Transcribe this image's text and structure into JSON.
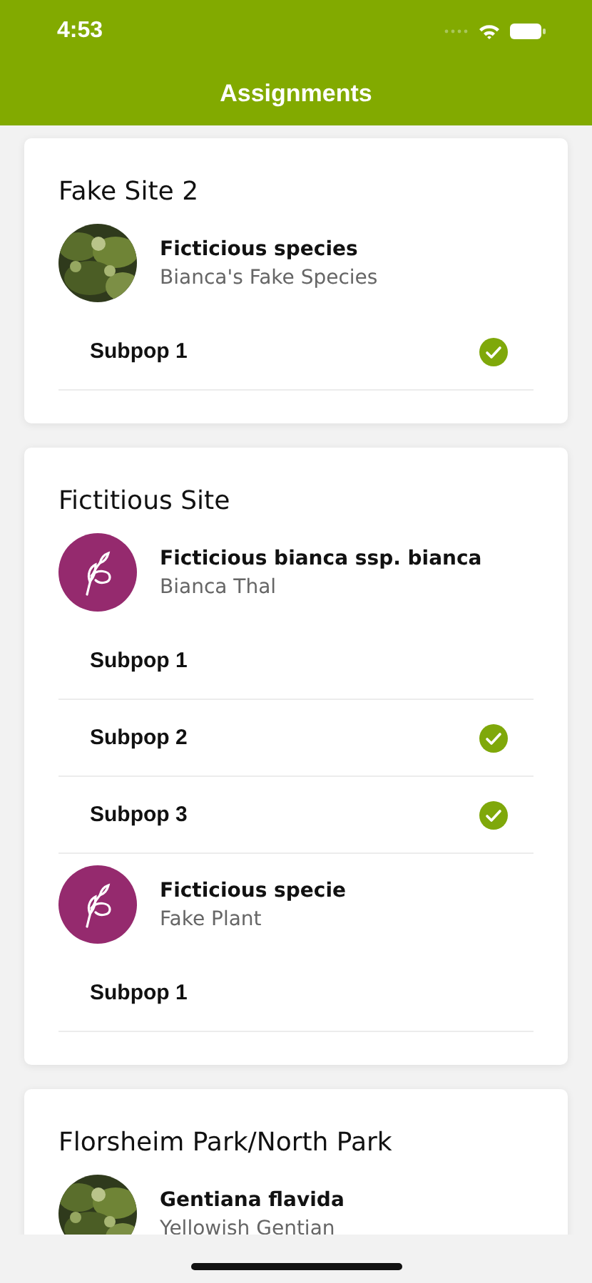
{
  "status_bar": {
    "time": "4:53"
  },
  "header": {
    "title": "Assignments"
  },
  "sites": [
    {
      "name": "Fake Site 2",
      "species": [
        {
          "name": "Ficticious species",
          "common_name": "Bianca's Fake Species",
          "subpops": [
            {
              "name": "Subpop 1",
              "done": true
            }
          ]
        }
      ]
    },
    {
      "name": "Fictitious Site",
      "species": [
        {
          "kind": "logo",
          "name": "Ficticious bianca ssp. bianca",
          "common_name": "Bianca Thal",
          "subpops": [
            {
              "name": "Subpop 1",
              "done": false
            },
            {
              "name": "Subpop 2",
              "done": true
            },
            {
              "name": "Subpop 3",
              "done": true
            }
          ]
        },
        {
          "kind": "logo",
          "name": "Ficticious specie",
          "common_name": "Fake Plant",
          "subpops": [
            {
              "name": "Subpop 1",
              "done": false
            }
          ]
        }
      ]
    },
    {
      "name": "Florsheim Park/North Park",
      "species": [
        {
          "name": "Gentiana flavida",
          "common_name": "Yellowish Gentian"
        }
      ]
    }
  ]
}
